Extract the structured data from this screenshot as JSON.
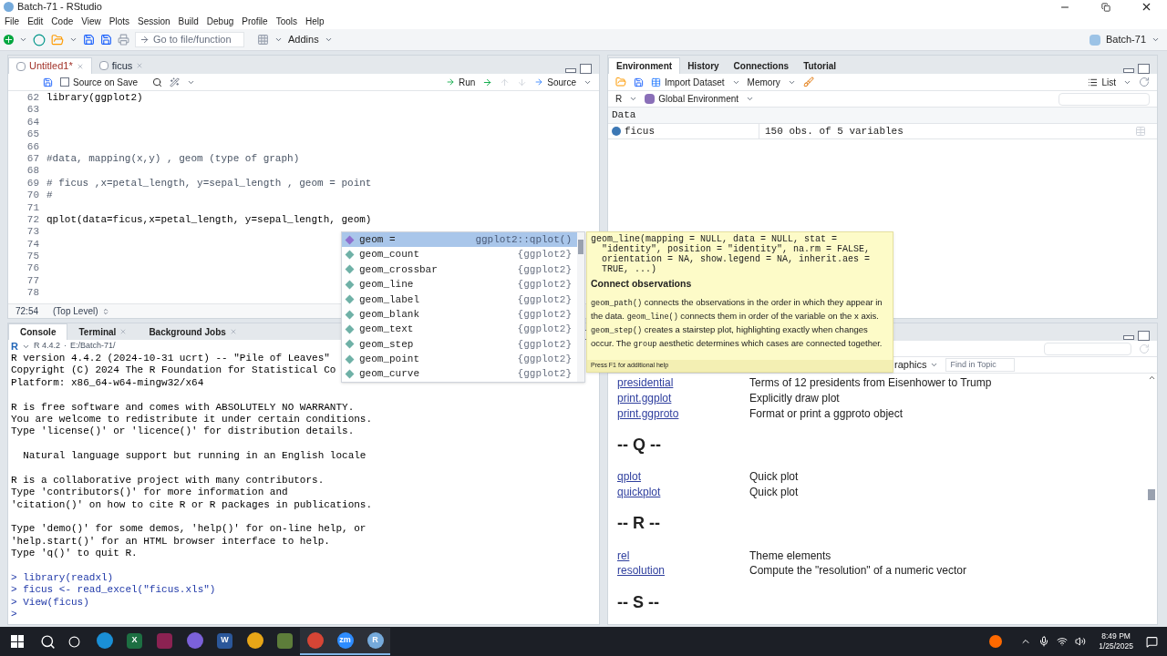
{
  "window": {
    "title": "Batch-71 - RStudio"
  },
  "menu": [
    "File",
    "Edit",
    "Code",
    "View",
    "Plots",
    "Session",
    "Build",
    "Debug",
    "Profile",
    "Tools",
    "Help"
  ],
  "toolbar": {
    "goto_placeholder": "Go to file/function",
    "addins": "Addins",
    "project": "Batch-71"
  },
  "editor": {
    "tabs": [
      {
        "label": "Untitled1*",
        "selected": true
      },
      {
        "label": "ficus",
        "selected": false
      }
    ],
    "source_on_save": {
      "label": "Source on Save",
      "checked": false
    },
    "run": "Run",
    "source": "Source",
    "lines": [
      {
        "num": "62",
        "code": "library(ggplot2)"
      },
      {
        "num": "63"
      },
      {
        "num": "64"
      },
      {
        "num": "65"
      },
      {
        "num": "66"
      },
      {
        "num": "67",
        "code": "#data, mapping(x,y) , geom (type of graph)"
      },
      {
        "num": "68"
      },
      {
        "num": "69",
        "code": "# ficus ,x=petal_length, y=sepal_length , geom = point"
      },
      {
        "num": "70",
        "code": "#"
      },
      {
        "num": "71"
      },
      {
        "num": "72",
        "code": "qplot(data=ficus,x=petal_length, y=sepal_length, geom)"
      },
      {
        "num": "73"
      },
      {
        "num": "74"
      },
      {
        "num": "75"
      },
      {
        "num": "76"
      },
      {
        "num": "77"
      },
      {
        "num": "78"
      }
    ],
    "position": "72:54",
    "scope": "(Top Level)"
  },
  "autocomplete": {
    "items": [
      {
        "name": "geom =",
        "source": "ggplot2::qplot()",
        "selected": true
      },
      {
        "name": "geom_count",
        "source": "{ggplot2}",
        "selected": false
      },
      {
        "name": "geom_crossbar",
        "source": "{ggplot2}",
        "selected": false
      },
      {
        "name": "geom_line",
        "source": "{ggplot2}",
        "selected": false
      },
      {
        "name": "geom_label",
        "source": "{ggplot2}",
        "selected": false
      },
      {
        "name": "geom_blank",
        "source": "{ggplot2}",
        "selected": false
      },
      {
        "name": "geom_text",
        "source": "{ggplot2}",
        "selected": false
      },
      {
        "name": "geom_step",
        "source": "{ggplot2}",
        "selected": false
      },
      {
        "name": "geom_point",
        "source": "{ggplot2}",
        "selected": false
      },
      {
        "name": "geom_curve",
        "source": "{ggplot2}",
        "selected": false
      }
    ]
  },
  "tooltip": {
    "signature": [
      "geom_line(mapping = NULL, data = NULL, stat =",
      "  \"identity\", position = \"identity\", na.rm = FALSE,",
      "  orientation = NA, show.legend = NA, inherit.aes =",
      "  TRUE, ...)"
    ],
    "heading": "Connect observations",
    "paragraph": [
      {
        "text": "geom_path()",
        "code": true
      },
      {
        "text": " connects the observations in the order in which they appear in the data. ",
        "code": false
      },
      {
        "text": "geom_line()",
        "code": true
      },
      {
        "text": " connects them in order of the variable on the x axis. ",
        "code": false
      },
      {
        "text": "geom_step()",
        "code": true
      },
      {
        "text": " creates a stairstep plot, highlighting exactly when changes occur. The ",
        "code": false
      },
      {
        "text": "group",
        "code": true
      },
      {
        "text": " aesthetic determines which cases are connected together.",
        "code": false
      }
    ],
    "footer": "Press F1 for additional help"
  },
  "console": {
    "tabs": [
      {
        "label": "Console",
        "selected": true,
        "closable": false
      },
      {
        "label": "Terminal",
        "selected": false,
        "closable": true
      },
      {
        "label": "Background Jobs",
        "selected": false,
        "closable": true
      }
    ],
    "r_logo": "R",
    "version": "R 4.4.2",
    "separator": "·",
    "path": "E:/Batch-71/",
    "blocks": [
      [
        "R version 4.4.2 (2024-10-31 ucrt) -- \"Pile of Leaves\"",
        "Copyright (C) 2024 The R Foundation for Statistical Co",
        "Platform: x86_64-w64-mingw32/x64"
      ],
      [
        "R is free software and comes with ABSOLUTELY NO WARRANTY.",
        "You are welcome to redistribute it under certain conditions.",
        "Type 'license()' or 'licence()' for distribution details."
      ],
      [
        "  Natural language support but running in an English locale"
      ],
      [
        "R is a collaborative project with many contributors.",
        "Type 'contributors()' for more information and",
        "'citation()' on how to cite R or R packages in publications."
      ],
      [
        "Type 'demo()' for some demos, 'help()' for on-line help, or",
        "'help.start()' for an HTML browser interface to help.",
        "Type 'q()' to quit R."
      ],
      [
        "> library(readxl)",
        "> ficus <- read_excel(\"ficus.xls\")",
        "> View(ficus)",
        ">"
      ]
    ]
  },
  "environment": {
    "tabs": [
      {
        "label": "Environment",
        "selected": true
      },
      {
        "label": "History",
        "selected": false
      },
      {
        "label": "Connections",
        "selected": false
      },
      {
        "label": "Tutorial",
        "selected": false
      }
    ],
    "import": "Import Dataset",
    "memory": "Memory",
    "view": "List",
    "language": "R",
    "scope": "Global Environment",
    "section": "Data",
    "rows": [
      {
        "name": "ficus",
        "value": "150 obs. of 5 variables"
      }
    ]
  },
  "help": {
    "topic_menu": "raphics",
    "find_placeholder": "Find in Topic",
    "entries": [
      {
        "kind": "link",
        "name": "presidential",
        "desc": "Terms of 12 presidents from Eisenhower to Trump"
      },
      {
        "kind": "link",
        "name": "print.ggplot",
        "desc": "Explicitly draw plot"
      },
      {
        "kind": "link",
        "name": "print.ggproto",
        "desc": "Format or print a ggproto object"
      },
      {
        "kind": "heading",
        "name": "-- Q --"
      },
      {
        "kind": "link",
        "name": "qplot",
        "desc": "Quick plot"
      },
      {
        "kind": "link",
        "name": "quickplot",
        "desc": "Quick plot"
      },
      {
        "kind": "heading",
        "name": "-- R --"
      },
      {
        "kind": "link",
        "name": "rel",
        "desc": "Theme elements"
      },
      {
        "kind": "link",
        "name": "resolution",
        "desc": "Compute the \"resolution\" of a numeric vector"
      },
      {
        "kind": "heading",
        "name": "-- S --"
      }
    ]
  },
  "taskbar": {
    "apps": [
      {
        "kind": "disc",
        "color": "#1a8fd6",
        "running": false
      },
      {
        "kind": "tile",
        "glyph": "X",
        "color": "#1d6f42",
        "running": false
      },
      {
        "kind": "tile",
        "color": "#8b2252",
        "running": false
      },
      {
        "kind": "disc",
        "color": "#7b61d9",
        "running": false
      },
      {
        "kind": "tile",
        "glyph": "W",
        "color": "#2b579a",
        "running": false
      },
      {
        "kind": "disc",
        "color": "#e8a617",
        "running": false
      },
      {
        "kind": "tile",
        "color": "#5d7d3a",
        "running": false
      },
      {
        "kind": "disc",
        "color": "#d64535",
        "running": true
      },
      {
        "kind": "disc",
        "glyph": "zm",
        "color": "#2d8cff",
        "running": true
      },
      {
        "kind": "disc",
        "glyph": "R",
        "color": "#75aadb",
        "running": true
      }
    ],
    "time": "8:49 PM",
    "date": "1/25/2025"
  }
}
